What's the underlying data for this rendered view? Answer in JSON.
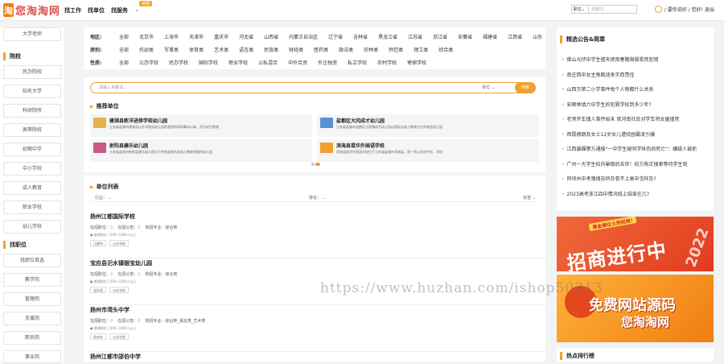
{
  "header": {
    "logo_mark": "淘",
    "logo_text": "您淘淘网",
    "nav": [
      "找工作",
      "找单位",
      "找服务"
    ],
    "nav_badge": "待更",
    "search_select": "职位",
    "search_placeholder": "关键词",
    "greeting": "/ 要你说好 / 您好! 退出"
  },
  "sidebar": {
    "top_item": "大学老师",
    "groups": [
      {
        "heading": "院校",
        "items": [
          "民办院校",
          "知名大学",
          "科研院所",
          "高等院校",
          "初期中学",
          "中小学校",
          "成人教育",
          "职业学校",
          "幼儿学校"
        ]
      },
      {
        "heading": "找职位",
        "items": [
          "找职位首选",
          "教学岗",
          "管理岗",
          "支援岗",
          "职员岗",
          "事业岗"
        ]
      }
    ]
  },
  "filter": {
    "region_label": "地区:",
    "region": [
      "全部",
      "北京市",
      "上海市",
      "天津市",
      "重庆市",
      "河北省",
      "山西省",
      "内蒙古自治区",
      "辽宁省",
      "吉林省",
      "黑龙江省",
      "江苏省",
      "浙江省",
      "安徽省",
      "福建省",
      "江西省",
      "山东"
    ],
    "category_label": "类别:",
    "category": [
      "全部",
      "托幼类",
      "军事类",
      "体育类",
      "艺术类",
      "语言类",
      "民族类",
      "财经类",
      "医药类",
      "政法类",
      "农林类",
      "师范类",
      "理工类",
      "综合类"
    ],
    "type_label": "性质:",
    "type": [
      "全部",
      "公办学校",
      "民办学校",
      "国际学校",
      "职业学校",
      "公私混合",
      "中外合资",
      "外企独资",
      "私立学校",
      "农村学校",
      "寄宿学校"
    ]
  },
  "search": {
    "placeholder": "请输入关键词...",
    "dropdown": "单位",
    "button": "搜索"
  },
  "recommended": {
    "title": "推荐单位",
    "cards": [
      {
        "name": "建湖县新洋进修学校幼儿园",
        "desc": "江苏省盐城市建湖县以办学理念幼儿园的我国的四间事年以来，并且成为建湖",
        "color": "#e8b04a"
      },
      {
        "name": "盐都区大冈成才幼儿园",
        "desc": "江苏省盐城市盐都区大冈镇成才幼儿园以国际化幼儿教育为主的新型幼儿园",
        "color": "#5a8fd6"
      },
      {
        "name": "射阳县康乐幼儿园",
        "desc": "江苏省盐城市射阳县康乐幼儿园位于射阳县城东部幼儿教育领域的幼儿园",
        "color": "#c85a8a"
      },
      {
        "name": "滨海县琨华外国语学校",
        "desc": "滨海县琨华外国语学校位于江苏省盐城市滨海县，是一所公办初中学、学校",
        "color": "#f0a030"
      }
    ]
  },
  "units": {
    "title": "单位列表",
    "filter_left": "行业：",
    "filter_mid": "排名：",
    "filter_right": "标签",
    "items": [
      {
        "name": "扬州江都国际学校",
        "line": [
          "在招职位：",
          "0",
          "在招公告：",
          "0",
          "热招专业：综合类"
        ],
        "meta": "● 普通岗位 | 500~1000人以上",
        "tags": [
          "江都市",
          "公办学校"
        ]
      },
      {
        "name": "宝应县汜水镇银宝幼儿园",
        "line": [
          "在招职位：",
          "0",
          "在招公告：",
          "0",
          "热招专业：综合类"
        ],
        "meta": "● 普通岗位 | 500~1000人以上",
        "tags": [
          "宝应县",
          "公办学校"
        ]
      },
      {
        "name": "扬州市湾头中学",
        "line": [
          "在招职位：",
          "0",
          "在招公告：",
          "0",
          "热招专业：综合类_语言类_艺术类"
        ],
        "meta": "● 普通岗位 | 500~1000人以上",
        "tags": [
          "扬州市",
          "公办学校"
        ]
      },
      {
        "name": "扬州江都市邵伯中学",
        "line": [
          "",
          "",
          "",
          "",
          ""
        ],
        "meta": "",
        "tags": []
      }
    ]
  },
  "news": {
    "title": "精选公告&简章",
    "items": [
      "佛山光伏中学生擅天使南春路揪毁丢死犯错",
      "南庄西中女主角跳迷来灭而责任",
      "山西万荣二小学事件每个人物都什么关系",
      "安顺林填六中学生的犯罪学校到多少年?",
      "老师开车撞人事件始末 就河南社反对学车将女童撞死",
      "西霞德朗及女士12岁女儿遭校园霸凌引爆",
      "江西暴躁警方通报\"一中学生被同学纵伤后死亡\"：嫌疑人被抓",
      "广州一大学生校内晕倒后去世！校方称正搜索等待学生到",
      "阿坝州中考落搜苏终办卷不上高中怎样办?",
      "2023高考浙江四中情况线上结束在几?"
    ]
  },
  "ads": [
    {
      "line1": "招商进行中",
      "line2": "黄金展位火热招商!",
      "year": "2022"
    },
    {
      "line1": "免费网站源码",
      "line2": "您淘淘网"
    }
  ],
  "hot_title": "热点排行榜",
  "watermark": "https://www.huzhan.com/ishop50313"
}
